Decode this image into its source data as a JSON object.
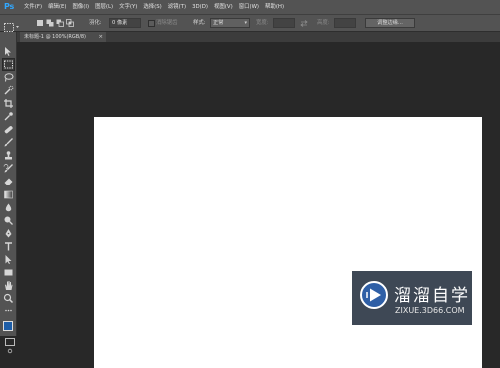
{
  "app": {
    "logo": "Ps"
  },
  "menu": [
    "文件(F)",
    "编辑(E)",
    "图像(I)",
    "图层(L)",
    "文字(Y)",
    "选择(S)",
    "滤镜(T)",
    "3D(D)",
    "视图(V)",
    "窗口(W)",
    "帮助(H)"
  ],
  "options": {
    "feather_label": "羽化:",
    "feather_value": "0 像素",
    "antialias_label": "消除锯齿",
    "style_label": "样式:",
    "style_value": "正常",
    "width_label": "宽度:",
    "height_label": "高度:",
    "refine_edge": "调整边缘..."
  },
  "document": {
    "tab_title": "未标题-1 @ 100%(RGB/8)",
    "close_symbol": "×"
  },
  "toolbar": {
    "tools": [
      "move-icon",
      "marquee-icon",
      "lasso-icon",
      "quick-select-icon",
      "crop-icon",
      "eyedropper-icon",
      "healing-brush-icon",
      "brush-icon",
      "clone-stamp-icon",
      "history-brush-icon",
      "eraser-icon",
      "gradient-icon",
      "blur-icon",
      "dodge-icon",
      "pen-icon",
      "type-icon",
      "path-select-icon",
      "rectangle-icon",
      "hand-icon",
      "zoom-icon"
    ],
    "foreground_color": "#1e5ea8",
    "background_color": "#f2f2f2"
  },
  "watermark": {
    "title": "溜溜自学",
    "url": "ZIXUE.3D66.COM",
    "brand_color": "#2b3a4d"
  }
}
